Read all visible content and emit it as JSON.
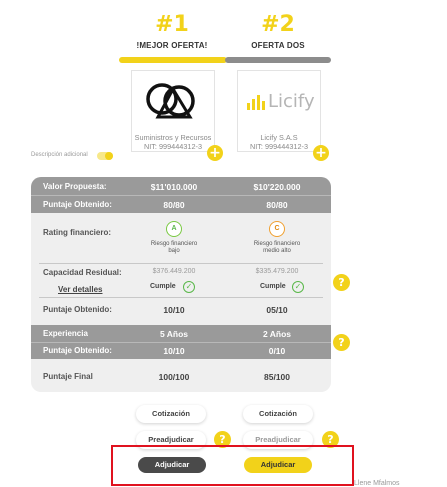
{
  "colors": {
    "accent": "#f2d21a",
    "band": "#9a9a9a",
    "panel": "#efefef",
    "dark_button": "#4a4a4a",
    "highlight": "#e0121f",
    "check": "#5ab84a"
  },
  "offers": [
    {
      "rank": "#1",
      "title": "!MEJOR OFERTA!",
      "logo": "rings-logo",
      "company": "Suministros y Recursos",
      "nit": "NIT: 999444312-3"
    },
    {
      "rank": "#2",
      "title": "OFERTA DOS",
      "logo": "licify-logo",
      "logo_text": "Licify",
      "company": "Licify S.A.S",
      "nit": "NIT: 999444312-3"
    }
  ],
  "toggle_label": "Descripción adicional",
  "table": {
    "propuesta": {
      "label": "Valor Propuesta:",
      "values": [
        "$11'010.000",
        "$10'220.000"
      ]
    },
    "puntaje1": {
      "label": "Puntaje Obtenido:",
      "values": [
        "80/80",
        "80/80"
      ]
    },
    "rating": {
      "label": "Rating financiero:",
      "grades": [
        "A",
        "C"
      ],
      "descriptions": [
        [
          "Riesgo financiero",
          "bajo"
        ],
        [
          "Riesgo financiero",
          "medio alto"
        ]
      ]
    },
    "capacidad": {
      "label": "Capacidad Residual:",
      "values": [
        "$376.449.200",
        "$335.479.200"
      ]
    },
    "detalles": {
      "link": "Ver detalles",
      "status": [
        "Cumple",
        "Cumple"
      ]
    },
    "puntaje2": {
      "label": "Puntaje Obtenido:",
      "values": [
        "10/10",
        "05/10"
      ]
    },
    "experiencia": {
      "label": "Experiencia",
      "values": [
        "5 Años",
        "2 Años"
      ]
    },
    "puntaje3": {
      "label": "Puntaje Obtenido:",
      "values": [
        "10/10",
        "0/10"
      ]
    },
    "final": {
      "label": "Puntaje Final",
      "values": [
        "100/100",
        "85/100"
      ]
    }
  },
  "buttons": {
    "cotizacion": "Cotización",
    "preadjudicar": "Preadjudicar",
    "adjudicar": "Adjudicar"
  },
  "cut_text": "Llene Mfalmos"
}
